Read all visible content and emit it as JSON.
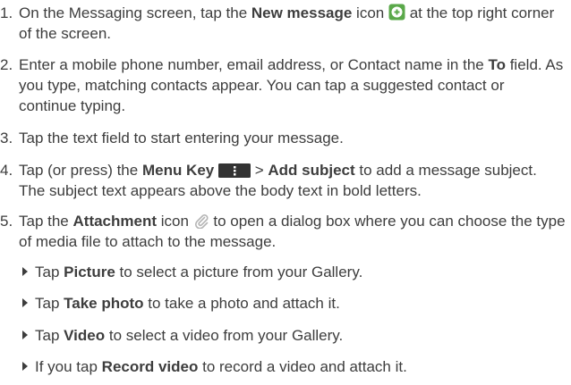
{
  "steps": [
    {
      "num": "1.",
      "a": "On the Messaging screen, tap the ",
      "b": "New message",
      "c": " icon ",
      "d": " at the top right corner of the screen."
    },
    {
      "num": "2.",
      "a": "Enter a mobile phone number, email address, or Contact name in the ",
      "b": "To",
      "c": " field. As you type, matching contacts appear. You can tap a suggested contact or continue typing."
    },
    {
      "num": "3.",
      "a": "Tap the text field to start entering your message."
    },
    {
      "num": "4.",
      "a": "Tap (or press) the ",
      "b": "Menu Key",
      "c": " > ",
      "d": "Add subject",
      "e": " to add a message subject. The subject text appears above the body text in bold letters."
    },
    {
      "num": "5.",
      "a": "Tap the ",
      "b": "Attachment",
      "c": " icon ",
      "d": " to open a dialog box where you can choose the type of media file to attach to the message."
    }
  ],
  "sub_items": [
    {
      "a": "Tap ",
      "b": "Picture",
      "c": " to select a picture from your Gallery."
    },
    {
      "a": "Tap ",
      "b": "Take photo",
      "c": " to take a photo and attach it."
    },
    {
      "a": "Tap ",
      "b": "Video",
      "c": " to select a video from your Gallery."
    },
    {
      "a": "If you tap ",
      "b": "Record video",
      "c": " to record a video and attach it."
    }
  ],
  "icons": {
    "new_message": "plus-circle-icon",
    "menu_key": "menu-key-icon",
    "attachment": "paperclip-icon",
    "bullet": "triangle-bullet-icon"
  },
  "colors": {
    "text": "#3d3d3d",
    "icon_green": "#5aa84a",
    "key_bg": "#333333"
  }
}
